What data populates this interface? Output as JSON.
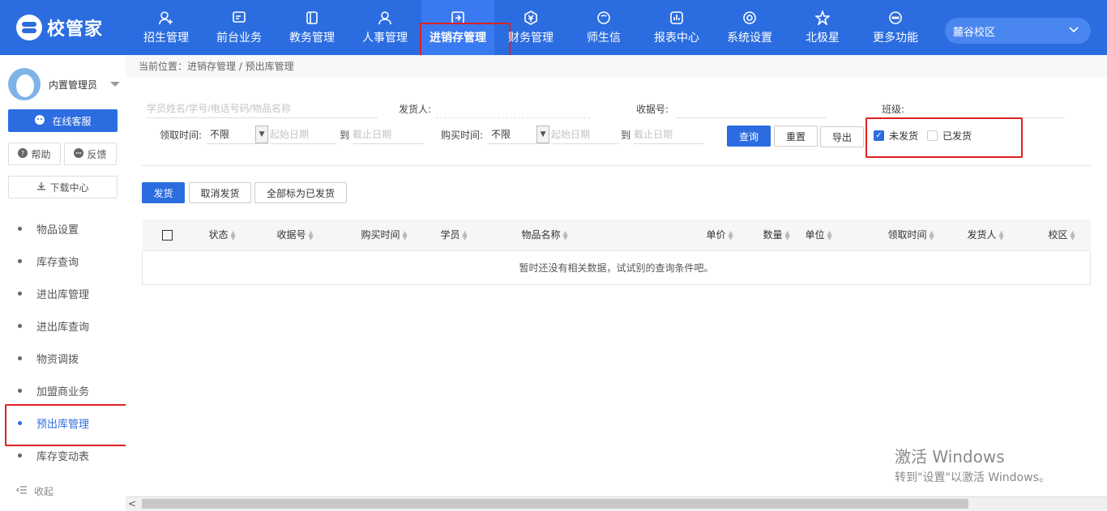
{
  "app": {
    "logo_text": "校管家"
  },
  "nav": [
    {
      "label": "招生管理",
      "icon": "add-user-icon"
    },
    {
      "label": "前台业务",
      "icon": "desk-icon"
    },
    {
      "label": "教务管理",
      "icon": "book-icon"
    },
    {
      "label": "人事管理",
      "icon": "person-icon"
    },
    {
      "label": "进销存管理",
      "icon": "inventory-icon",
      "active": true
    },
    {
      "label": "财务管理",
      "icon": "yuan-icon"
    },
    {
      "label": "师生信",
      "icon": "chat-icon"
    },
    {
      "label": "报表中心",
      "icon": "report-icon"
    },
    {
      "label": "系统设置",
      "icon": "settings-icon"
    },
    {
      "label": "北极星",
      "icon": "star-icon"
    },
    {
      "label": "更多功能",
      "icon": "more-icon"
    }
  ],
  "campus": {
    "label": "麓谷校区"
  },
  "sidebar": {
    "user_name": "内置管理员",
    "service_label": "在线客服",
    "help_label": "帮助",
    "feedback_label": "反馈",
    "download_label": "下载中心",
    "items": [
      {
        "label": "物品设置"
      },
      {
        "label": "库存查询"
      },
      {
        "label": "进出库管理"
      },
      {
        "label": "进出库查询"
      },
      {
        "label": "物资调拨"
      },
      {
        "label": "加盟商业务"
      },
      {
        "label": "预出库管理",
        "active": true
      },
      {
        "label": "库存变动表"
      }
    ],
    "collapse_label": "收起"
  },
  "breadcrumb": "当前位置：进销存管理 / 预出库管理",
  "filters": {
    "search_placeholder": "学员姓名/学号/电话号码/物品名称",
    "sender_label": "发货人:",
    "receipt_label": "收据号:",
    "class_label": "班级:",
    "receive_time_label": "领取时间:",
    "receive_time_value": "不限",
    "start_placeholder": "起始日期",
    "to_label": "到",
    "end_placeholder": "截止日期",
    "purchase_time_label": "购买时间:",
    "purchase_time_value": "不限",
    "query_label": "查询",
    "reset_label": "重置",
    "export_label": "导出",
    "unshipped_label": "未发货",
    "shipped_label": "已发货"
  },
  "actions": {
    "ship_label": "发货",
    "cancel_ship_label": "取消发货",
    "mark_all_label": "全部标为已发货"
  },
  "table": {
    "columns": [
      "状态",
      "收据号",
      "购买时间",
      "学员",
      "物品名称",
      "单价",
      "数量",
      "单位",
      "领取时间",
      "发货人",
      "校区"
    ],
    "empty_text": "暂时还没有相关数据，试试别的查询条件吧。"
  },
  "watermark": {
    "line1": "激活 Windows",
    "line2": "转到\"设置\"以激活 Windows。"
  },
  "colors": {
    "primary": "#2b6de0",
    "highlight": "#e02020"
  }
}
